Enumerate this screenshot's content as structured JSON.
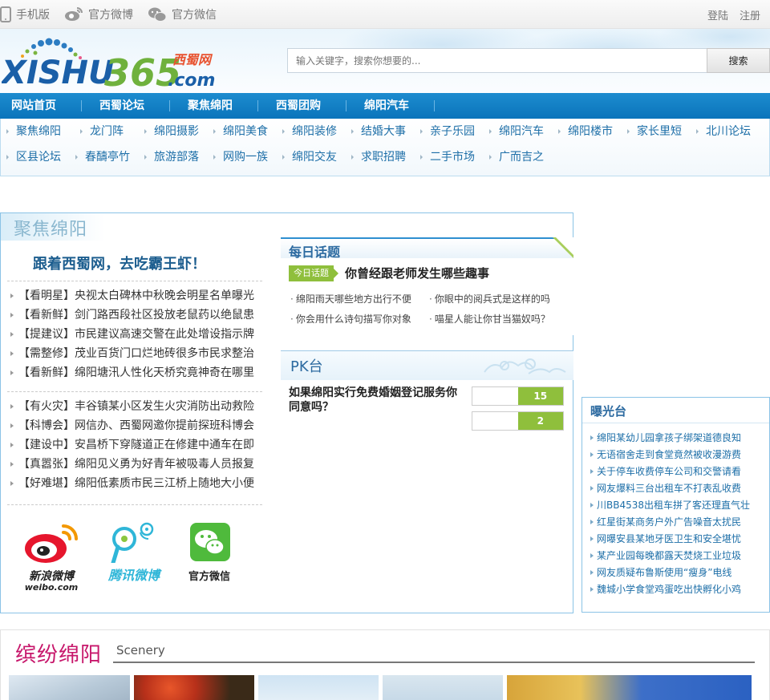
{
  "topbar": {
    "left": [
      "手机版",
      "官方微博",
      "官方微信"
    ],
    "right": [
      "登陆",
      "注册"
    ]
  },
  "logo": {
    "main": "XISHU",
    "num": "365",
    "cn": "西蜀网",
    "com": ".com"
  },
  "search": {
    "placeholder": "输入关键字，搜索你想要的...",
    "button": "搜索"
  },
  "nav": [
    "网站首页",
    "西蜀论坛",
    "聚焦绵阳",
    "西蜀团购",
    "绵阳汽车"
  ],
  "subnav": {
    "row1": [
      "聚焦绵阳",
      "龙门阵",
      "绵阳摄影",
      "绵阳美食",
      "绵阳装修",
      "结婚大事",
      "亲子乐园",
      "绵阳汽车",
      "绵阳楼市",
      "家长里短",
      "北川论坛"
    ],
    "row2": [
      "区县论坛",
      "春醻亭竹",
      "旅游部落",
      "网购一族",
      "绵阳交友",
      "求职招聘",
      "二手市场",
      "广而吉之"
    ]
  },
  "focus": {
    "title": "聚焦绵阳",
    "headline": "跟着西蜀网，去吃霸王虾！",
    "news1": [
      "【看明星】央视太白碑林中秋晚会明星名单曝光",
      "【看新鲜】剑门路西段社区投放老鼠药以绝鼠患",
      "【提建议】市民建议高速交警在此处增设指示牌",
      "【需整修】茂业百货门口烂地砖很多市民求整治",
      "【看新鲜】绵阳塘汛人性化天桥究竟神奇在哪里"
    ],
    "news2": [
      "【有火灾】丰谷镇某小区发生火灾消防出动救险",
      "【科博会】网信办、西蜀网邀你提前探班科博会",
      "【建设中】安昌桥下穿隧道正在修建中通车在即",
      "【真嚣张】绵阳见义勇为好青年被吸毒人员报复",
      "【好难堪】绵阳低素质市民三江桥上随地大小便"
    ],
    "social": {
      "weibo": "新浪微博",
      "weibo_en": "weibo.com",
      "tencent": "腾讯微博",
      "wechat": "官方微信"
    }
  },
  "daily": {
    "title": "每日话题",
    "tag": "今日话题",
    "question": "你曾经跟老师发生哪些趣事",
    "topics": [
      "绵阳雨天哪些地方出行不便",
      "你眼中的阅兵式是这样的吗",
      "你会用什么诗句描写你对象",
      "喵星人能让你甘当猫奴吗？"
    ]
  },
  "pk": {
    "title": "PK台",
    "question": "如果绵阳实行免费婚姻登记服务你同意吗？",
    "votes": [
      {
        "count": "15",
        "fraction": 0.5
      },
      {
        "count": "2",
        "fraction": 0.5
      }
    ]
  },
  "exposure": {
    "title": "曝光台",
    "items": [
      "绵阳某幼儿园拿孩子绑架道德良知",
      "无语宿舍走到食堂竟然被收漫游费",
      "关于停车收费停车公司和交警请看",
      "网友爆料三台出租车不打表乱收费",
      "川BB4538出租车拼了客还理直气壮",
      "红星街某商务户外广告噪音太扰民",
      "网曝安县某地牙医卫生和安全堪忧",
      "某产业园每晚都露天焚烧工业垃圾",
      "网友质疑布鲁斯使用“瘦身”电线",
      "魏城小学食堂鸡蛋吃出快孵化小鸡"
    ]
  },
  "scenery": {
    "title": "缤纷绵阳",
    "subtitle": "Scenery"
  }
}
